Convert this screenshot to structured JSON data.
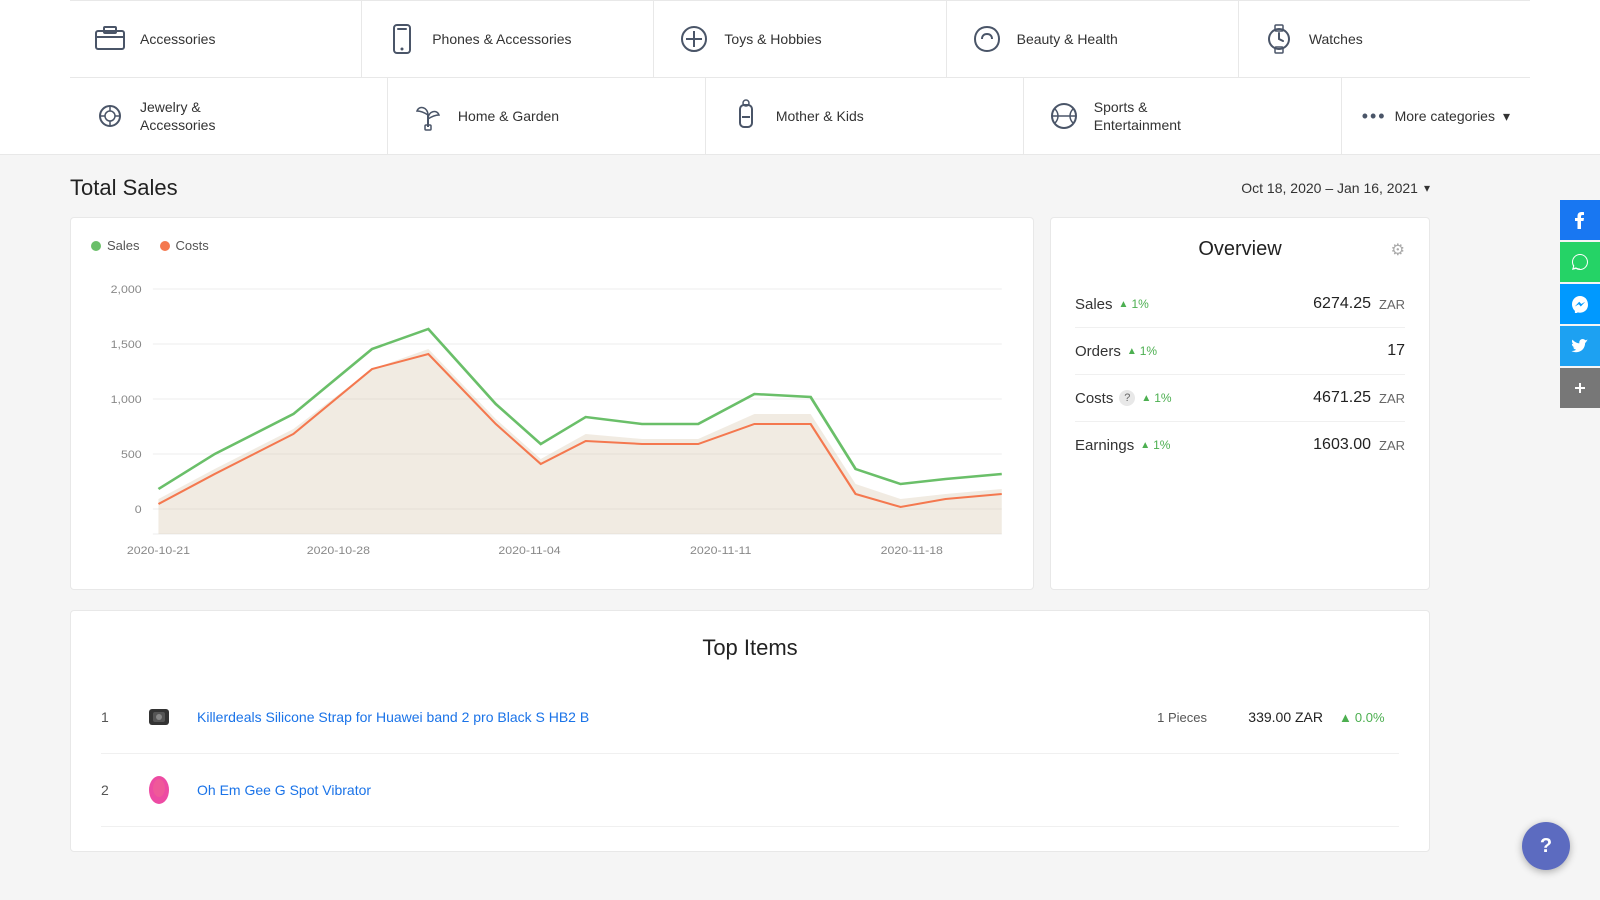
{
  "categories": {
    "row1": [
      {
        "id": "accessories",
        "label": "Accessories",
        "icon": "accessories"
      },
      {
        "id": "phones-accessories",
        "label": "Phones & Accessories",
        "icon": "phones"
      },
      {
        "id": "toys-hobbies",
        "label": "Toys & Hobbies",
        "icon": "toys"
      },
      {
        "id": "beauty-health",
        "label": "Beauty & Health",
        "icon": "beauty"
      },
      {
        "id": "watches",
        "label": "Watches",
        "icon": "watches"
      }
    ],
    "row2": [
      {
        "id": "jewelry",
        "label": "Jewelry & Accessories",
        "icon": "jewelry"
      },
      {
        "id": "home-garden",
        "label": "Home & Garden",
        "icon": "garden"
      },
      {
        "id": "mother-kids",
        "label": "Mother & Kids",
        "icon": "mother"
      },
      {
        "id": "sports",
        "label": "Sports & Entertainment",
        "icon": "sports"
      }
    ],
    "more_label": "More categories"
  },
  "total_sales": {
    "title": "Total Sales",
    "date_range": "Oct 18, 2020 – Jan 16, 2021",
    "legend": {
      "sales_label": "Sales",
      "costs_label": "Costs",
      "sales_color": "#6abf69",
      "costs_color": "#f4784f"
    },
    "chart": {
      "y_labels": [
        "2,000",
        "1,500",
        "1,000",
        "500",
        "0"
      ],
      "x_labels": [
        "2020-10-21",
        "2020-10-28",
        "2020-11-04",
        "2020-11-11",
        "2020-11-18"
      ]
    }
  },
  "overview": {
    "title": "Overview",
    "rows": [
      {
        "label": "Sales",
        "trend": "1%",
        "value": "6274.25",
        "currency": "ZAR",
        "has_help": false
      },
      {
        "label": "Orders",
        "trend": "1%",
        "value": "17",
        "currency": "",
        "has_help": false
      },
      {
        "label": "Costs",
        "trend": "1%",
        "value": "4671.25",
        "currency": "ZAR",
        "has_help": true
      },
      {
        "label": "Earnings",
        "trend": "1%",
        "value": "1603.00",
        "currency": "ZAR",
        "has_help": false
      }
    ]
  },
  "top_items": {
    "title": "Top Items",
    "items": [
      {
        "rank": "1",
        "name": "Killerdeals Silicone Strap for Huawei band 2 pro Black S HB2 B",
        "pieces": "1 Pieces",
        "price": "339.00 ZAR",
        "change": "0.0%",
        "icon_color": "#444"
      },
      {
        "rank": "2",
        "name": "Oh Em Gee G Spot Vibrator",
        "pieces": "",
        "price": "",
        "change": "",
        "icon_color": "#e91e8c"
      }
    ]
  },
  "social": {
    "buttons": [
      "facebook",
      "whatsapp",
      "messenger",
      "twitter",
      "plus"
    ]
  },
  "help": {
    "label": "?"
  }
}
